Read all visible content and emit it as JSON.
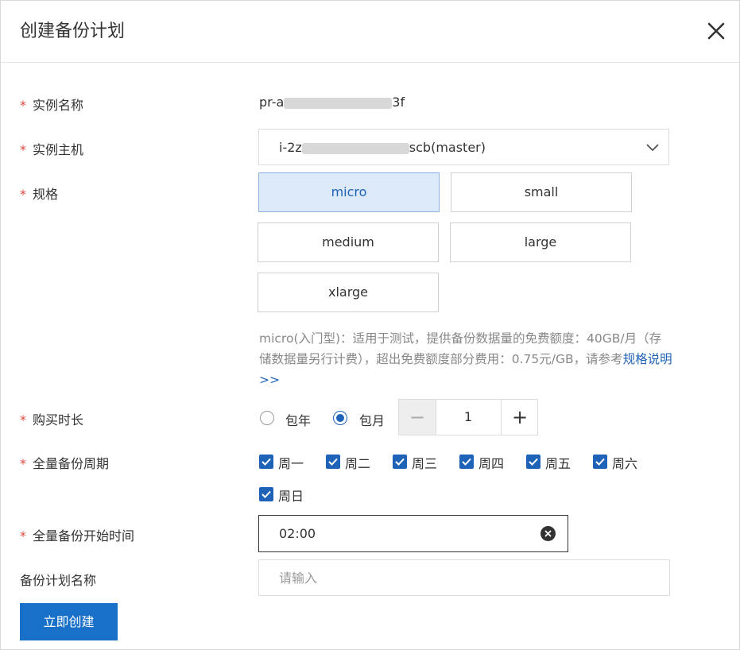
{
  "dialog": {
    "title": "创建备份计划",
    "close_icon": "close-icon"
  },
  "form": {
    "instance_name": {
      "label": "实例名称",
      "prefix": "pr-a",
      "suffix": "3f"
    },
    "instance_host": {
      "label": "实例主机",
      "prefix": "i-2z",
      "suffix": "scb(master)",
      "icon": "chevron-down-icon"
    },
    "spec": {
      "label": "规格",
      "options": [
        "micro",
        "small",
        "medium",
        "large",
        "xlarge"
      ],
      "selected": "micro",
      "description": "micro(入门型)：适用于测试，提供备份数据量的免费额度：40GB/月（存储数据量另行计费），超出免费额度部分费用：0.75元/GB，请参考",
      "link": "规格说明>>"
    },
    "duration": {
      "label": "购买时长",
      "options": [
        "包年",
        "包月"
      ],
      "selected": "包月",
      "quantity": "1",
      "minus": "−",
      "plus": "+"
    },
    "full_backup_cycle": {
      "label": "全量备份周期",
      "days": [
        "周一",
        "周二",
        "周三",
        "周四",
        "周五",
        "周六",
        "周日"
      ],
      "checked": [
        true,
        true,
        true,
        true,
        true,
        true,
        true
      ]
    },
    "start_time": {
      "label": "全量备份开始时间",
      "value": "02:00",
      "icon": "clear-icon"
    },
    "plan_name": {
      "label": "备份计划名称",
      "placeholder": "请输入"
    },
    "required_mark": "*"
  },
  "actions": {
    "create_label": "立即创建"
  },
  "colors": {
    "primary": "#1870c9",
    "link": "#1f63b8",
    "required": "#e0493a",
    "selected_bg": "#dce9f8"
  }
}
